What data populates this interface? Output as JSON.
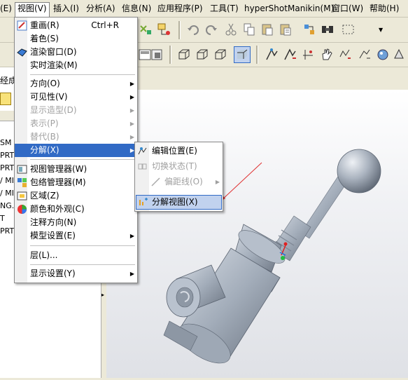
{
  "menubar": {
    "items": [
      "(E)",
      "视图(V)",
      "插入(I)",
      "分析(A)",
      "信息(N)",
      "应用程序(P)",
      "工具(T)",
      "hyperShot",
      "Manikin(M)",
      "窗口(W)",
      "帮助(H)"
    ]
  },
  "left_panel": {
    "label_fragment": "经成",
    "tree_items": [
      "SM",
      "PRT",
      "PRT",
      "/ MIR",
      "/ MIR",
      "NG.P",
      "T",
      "PRT"
    ]
  },
  "view_menu": {
    "items": [
      {
        "label": "重画(R)",
        "shortcut": "Ctrl+R",
        "icon": "repaint-icon"
      },
      {
        "label": "着色(S)"
      },
      {
        "label": "渲染窗口(D)",
        "icon": "render-window-icon"
      },
      {
        "label": "实时渲染(M)"
      },
      {
        "label": "方向(O)",
        "submenu": true
      },
      {
        "label": "可见性(V)",
        "submenu": true
      },
      {
        "label": "显示造型(D)",
        "submenu": true,
        "disabled": true
      },
      {
        "label": "表示(P)",
        "submenu": true,
        "disabled": true
      },
      {
        "label": "替代(B)",
        "submenu": true,
        "disabled": true
      },
      {
        "label": "分解(X)",
        "submenu": true,
        "highlighted": true
      },
      {
        "label": "视图管理器(W)",
        "icon": "view-manager-icon"
      },
      {
        "label": "包络管理器(M)",
        "icon": "envelope-manager-icon"
      },
      {
        "label": "区域(Z)",
        "icon": "zone-icon"
      },
      {
        "label": "颜色和外观(C)",
        "icon": "color-appearance-icon"
      },
      {
        "label": "注释方向(N)"
      },
      {
        "label": "模型设置(E)",
        "submenu": true
      },
      {
        "label": "层(L)..."
      },
      {
        "label": "显示设置(Y)",
        "submenu": true
      }
    ]
  },
  "explode_submenu": {
    "items": [
      {
        "label": "编辑位置(E)",
        "icon": "edit-position-icon"
      },
      {
        "label": "切换状态(T)",
        "disabled": true,
        "icon": "toggle-state-icon"
      },
      {
        "label": "偏距线(O)",
        "disabled": true,
        "submenu": true,
        "icon": "offset-line-icon"
      },
      {
        "label": "分解视图(X)",
        "icon": "explode-view-icon",
        "boxed": true
      }
    ]
  },
  "colors": {
    "highlight": "#316ac5",
    "annotation_arrow": "#e03030",
    "part_fill": "#a9b3c0"
  }
}
